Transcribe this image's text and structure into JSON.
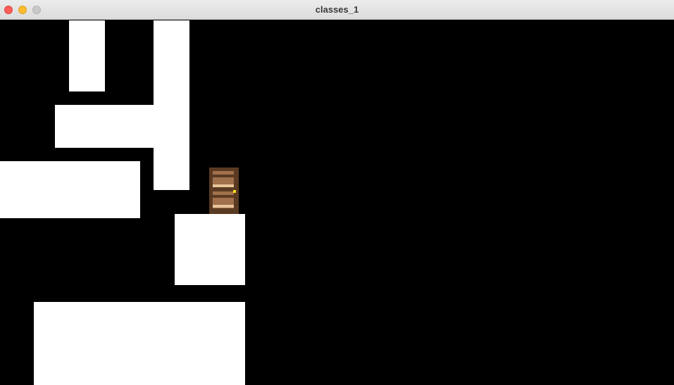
{
  "window": {
    "title": "classes_1"
  },
  "titlebar_buttons": {
    "close": "close-button",
    "minimize": "minimize-button",
    "maximize": "maximize-button"
  },
  "colors": {
    "background": "#000000",
    "wall": "#ffffff",
    "door_frame": "#5a3a22",
    "door_panel": "#a0714c",
    "door_knob": "#ffe11a"
  },
  "scene": {
    "walls": [
      "wall-1",
      "wall-2",
      "wall-3",
      "wall-4",
      "wall-5",
      "wall-6"
    ],
    "door": "door-icon"
  }
}
